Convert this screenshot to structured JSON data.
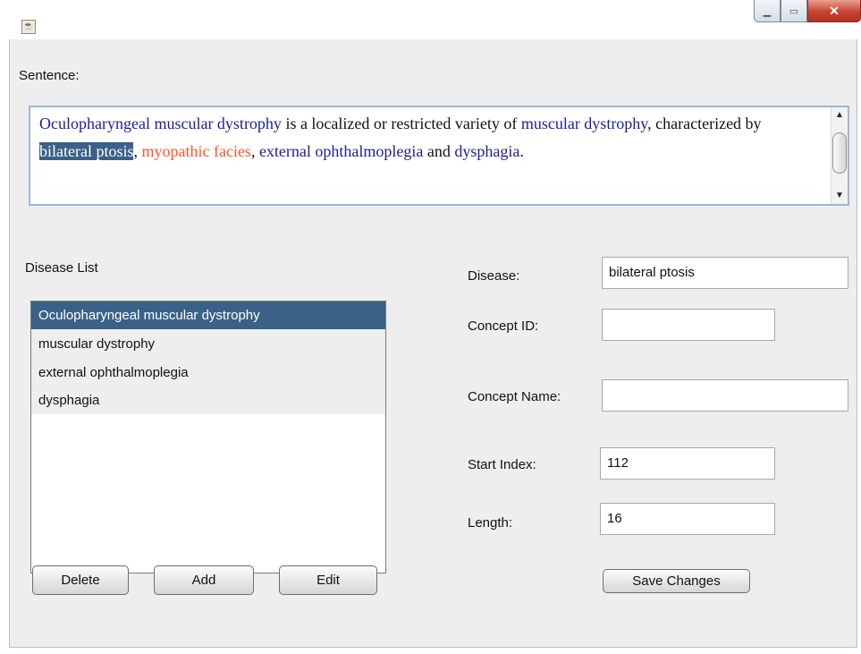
{
  "window": {
    "app_icon": "java-cup-icon",
    "controls": {
      "minimize": "minimize-icon",
      "maximize": "maximize-icon",
      "close": "close-icon"
    }
  },
  "sentence_label": "Sentence:",
  "sentence": {
    "segments": [
      {
        "text": "Oculopharyngeal muscular dystrophy",
        "type": "entity"
      },
      {
        "text": " is a localized or restricted variety of ",
        "type": "plain"
      },
      {
        "text": "muscular dystrophy",
        "type": "entity"
      },
      {
        "text": ", characterized by ",
        "type": "plain"
      },
      {
        "text": "bilateral ptosis",
        "type": "selected"
      },
      {
        "text": ", ",
        "type": "plain"
      },
      {
        "text": "myopathic facies",
        "type": "highlight"
      },
      {
        "text": ", ",
        "type": "plain"
      },
      {
        "text": "external ophthalmoplegia",
        "type": "entity"
      },
      {
        "text": " and ",
        "type": "plain"
      },
      {
        "text": "dysphagia",
        "type": "entity"
      },
      {
        "text": ".",
        "type": "plain"
      }
    ]
  },
  "disease_list": {
    "label": "Disease List",
    "items": [
      "Oculopharyngeal muscular dystrophy",
      "muscular dystrophy",
      "external ophthalmoplegia",
      "dysphagia"
    ],
    "selected_index": 0
  },
  "buttons": {
    "delete": "Delete",
    "add": "Add",
    "edit": "Edit",
    "save": "Save Changes"
  },
  "form": {
    "disease_label": "Disease:",
    "disease_value": "bilateral ptosis",
    "concept_id_label": "Concept ID:",
    "concept_id_value": "",
    "concept_name_label": "Concept Name:",
    "concept_name_value": "",
    "start_index_label": "Start Index:",
    "start_index_value": "112",
    "length_label": "Length:",
    "length_value": "16"
  },
  "colors": {
    "entity": "#1c1c9c",
    "highlight": "#ff5522",
    "selection": "#3a6187"
  }
}
